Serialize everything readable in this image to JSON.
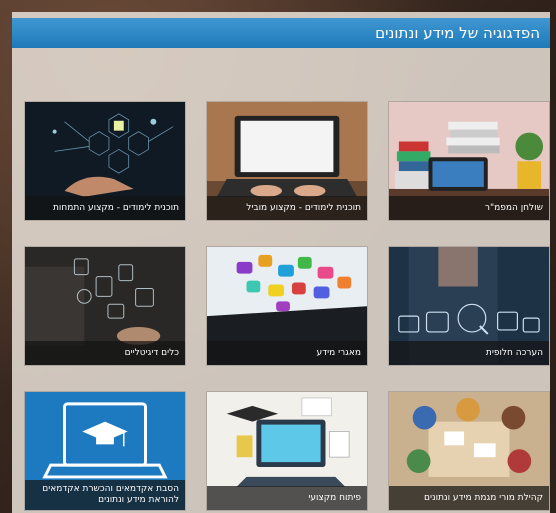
{
  "header": {
    "title": "הפדגוגיה של מידע ונתונים"
  },
  "tiles": [
    {
      "label": "תוכנית לימודים - מקצוע התמחות"
    },
    {
      "label": "תוכנית לימודים - מקצוע מוביל"
    },
    {
      "label": "שולחן המפמ\"ר"
    },
    {
      "label": "כלים דיגיטליים"
    },
    {
      "label": "מאגרי מידע"
    },
    {
      "label": "הערכה חלופית"
    },
    {
      "label": "הסבת אקדמאים והכשרת אקדמאים\nלהוראת מידע ונתונים"
    },
    {
      "label": "פיתוח מקצועי"
    },
    {
      "label": "קהילת מורי מגמת מידע ונתונים"
    }
  ],
  "colors": {
    "header": "#2a86c6",
    "caption_bg": "#141414"
  }
}
